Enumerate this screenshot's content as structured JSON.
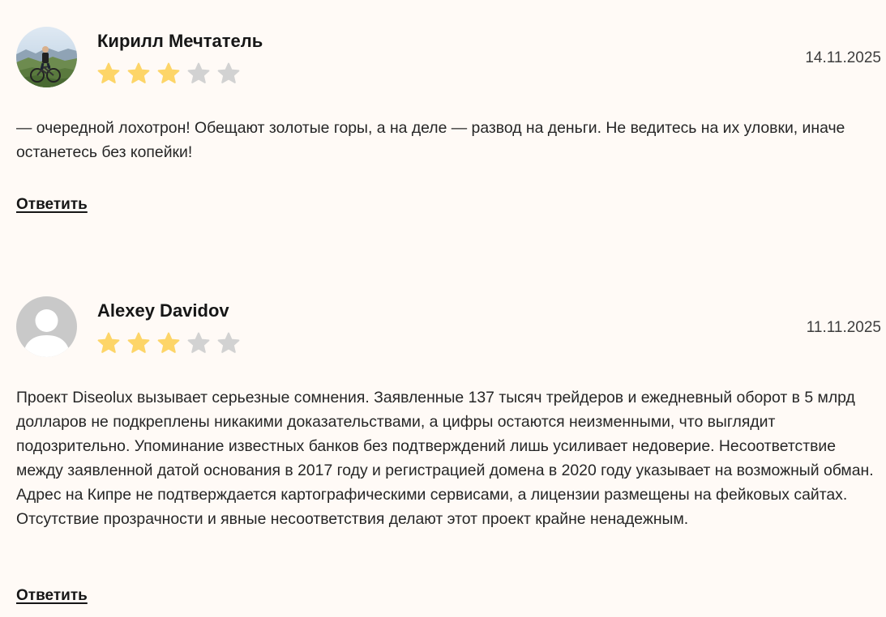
{
  "colors": {
    "star_filled": "#fdd568",
    "star_empty": "#d2d2d2",
    "background": "#fffaf6"
  },
  "reviews": [
    {
      "author": "Кирилл Мечтатель",
      "avatar": "photo-avatar",
      "rating": 3,
      "max_rating": 5,
      "date": "14.11.2025",
      "text": "— очередной лохотрон! Обещают золотые горы, а на деле — развод на деньги. Не ведитесь на их уловки, иначе останетесь без копейки!",
      "reply_label": "Ответить"
    },
    {
      "author": "Alexey Davidov",
      "avatar": "default-user-avatar",
      "rating": 3,
      "max_rating": 5,
      "date": "11.11.2025",
      "text": "Проект Diseolux вызывает серьезные сомнения. Заявленные 137 тысяч трейдеров и ежедневный оборот в 5 млрд долларов не подкреплены никакими доказательствами, а цифры остаются неизменными, что выглядит подозрительно. Упоминание известных банков без подтверждений лишь усиливает недоверие. Несоответствие между заявленной датой основания в 2017 году и регистрацией домена в 2020 году указывает на возможный обман. Адрес на Кипре не подтверждается картографическими сервисами, а лицензии размещены на фейковых сайтах. Отсутствие прозрачности и явные несоответствия делают этот проект крайне ненадежным.",
      "reply_label": "Ответить"
    }
  ]
}
